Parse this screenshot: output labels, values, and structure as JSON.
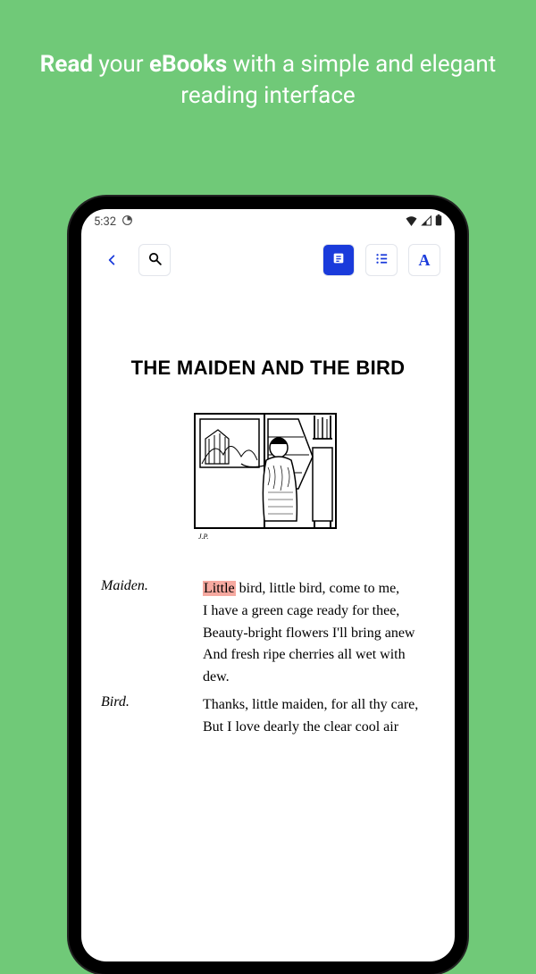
{
  "promo_prefix_bold": "Read",
  "promo_mid": " your ",
  "promo_mid_bold": "eBooks",
  "promo_suffix": " with a simple and elegant reading interface",
  "status": {
    "time": "5:32"
  },
  "chapter_title": "THE MAIDEN AND THE BIRD",
  "dialogue": {
    "speaker1": "Maiden.",
    "speech1_highlight": "Little",
    "speech1_rest": " bird, little bird, come to me,\nI have a green cage ready for thee,\nBeauty-bright flowers I'll bring anew\nAnd fresh ripe cherries all wet with dew.",
    "speaker2": "Bird.",
    "speech2": "Thanks, little maiden, for all thy care,\nBut I love dearly the clear cool air"
  }
}
